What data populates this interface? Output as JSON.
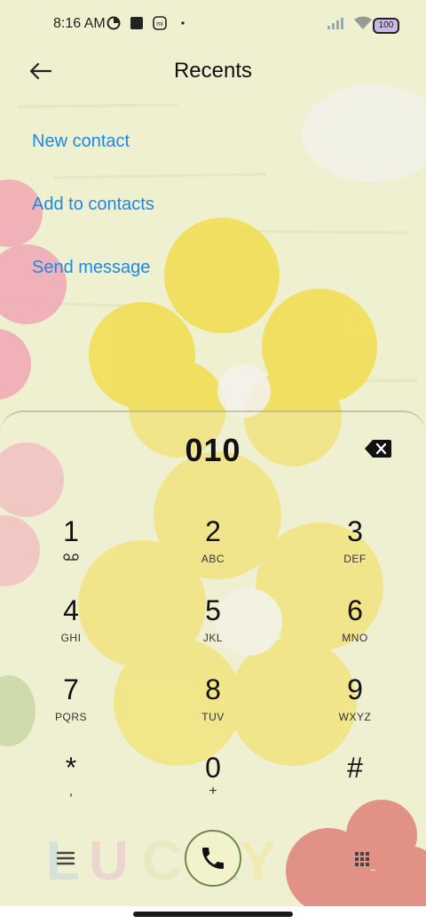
{
  "status_bar": {
    "time": "8:16 AM",
    "battery": "100",
    "icons_left": [
      "data-saver-icon",
      "stop-square-icon",
      "mi-icon",
      "dot-icon"
    ],
    "icons_right": [
      "signal-icon",
      "wifi-icon",
      "battery-icon"
    ]
  },
  "header": {
    "title": "Recents",
    "back_icon": "arrow-left-icon"
  },
  "actions": {
    "new_contact": "New contact",
    "add_to_contacts": "Add to contacts",
    "send_message": "Send message"
  },
  "dialer": {
    "number": "010",
    "delete_icon": "backspace-icon",
    "keys": [
      {
        "digit": "1",
        "sub": "voicemail"
      },
      {
        "digit": "2",
        "sub": "ABC"
      },
      {
        "digit": "3",
        "sub": "DEF"
      },
      {
        "digit": "4",
        "sub": "GHI"
      },
      {
        "digit": "5",
        "sub": "JKL"
      },
      {
        "digit": "6",
        "sub": "MNO"
      },
      {
        "digit": "7",
        "sub": "PQRS"
      },
      {
        "digit": "8",
        "sub": "TUV"
      },
      {
        "digit": "9",
        "sub": "WXYZ"
      },
      {
        "digit": "*",
        "sub": ","
      },
      {
        "digit": "0",
        "sub": "+"
      },
      {
        "digit": "#",
        "sub": ""
      }
    ]
  },
  "bottom_bar": {
    "menu_icon": "menu-icon",
    "call_icon": "phone-icon",
    "keypad_icon": "dialpad-icon"
  },
  "wallpaper": {
    "decorative_text": "LUCKY",
    "colors": {
      "base": "#eef0d0",
      "yellow_flower": "#f1de55",
      "pink_flower": "#f1a7b4",
      "red_flower": "#d64646",
      "accent_link": "#1e88e5",
      "call_border": "#6b8a46"
    }
  }
}
